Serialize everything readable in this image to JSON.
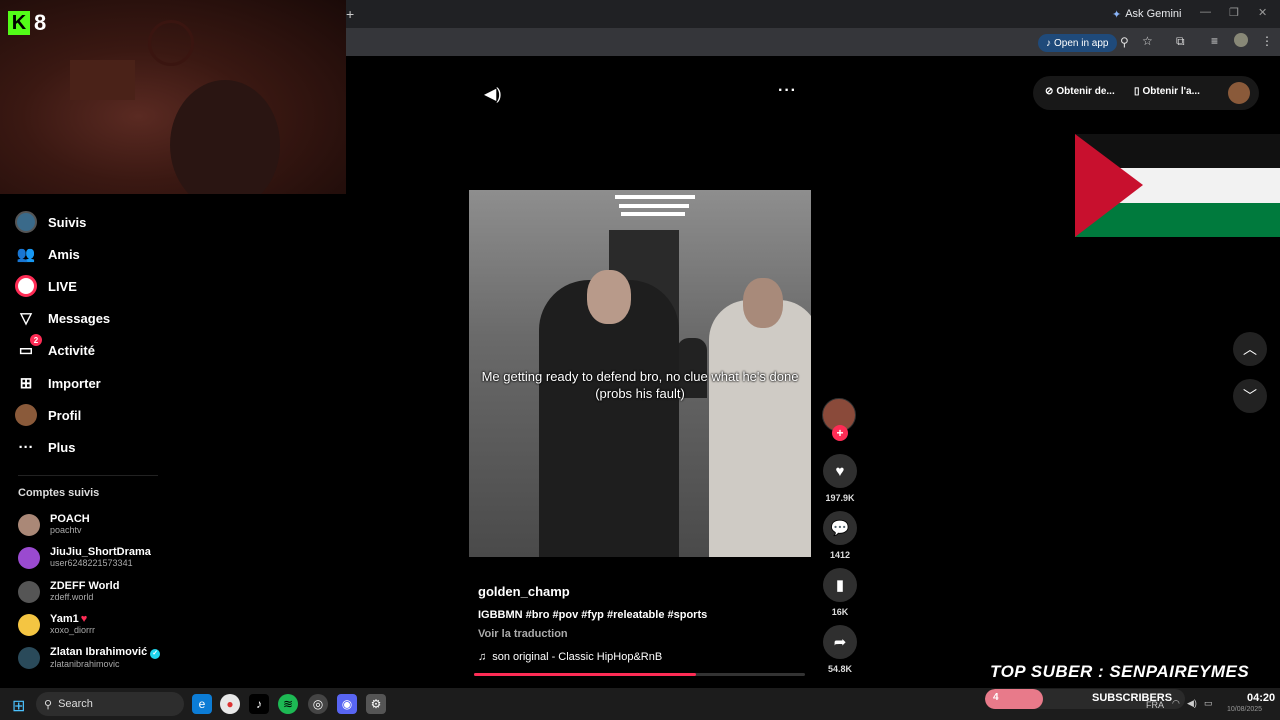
{
  "browser": {
    "new_tab_icon": "plus-icon",
    "ask_gemini": "Ask Gemini",
    "open_in_app": "Open in app"
  },
  "stream_overlay": {
    "platform_logo": "K",
    "viewer_count": "8",
    "top_suber": "TOP SUBER : SENPAIREYMES",
    "subscribers_label": "SUBSCRIBERS",
    "subscribers_count": "4",
    "subscribers_progress": 0.29
  },
  "sidebar": {
    "items": [
      {
        "label": "Suivis",
        "icon": "following-avatar-icon"
      },
      {
        "label": "Amis",
        "icon": "friends-icon"
      },
      {
        "label": "LIVE",
        "icon": "live-icon"
      },
      {
        "label": "Messages",
        "icon": "messages-icon"
      },
      {
        "label": "Activité",
        "icon": "activity-icon",
        "badge": "2"
      },
      {
        "label": "Importer",
        "icon": "upload-icon"
      },
      {
        "label": "Profil",
        "icon": "profile-icon"
      },
      {
        "label": "Plus",
        "icon": "more-icon"
      }
    ],
    "following_title": "Comptes suivis",
    "following": [
      {
        "name": "POACH",
        "handle": "poachtv"
      },
      {
        "name": "JiuJiu_ShortDrama",
        "handle": "user6248221573341"
      },
      {
        "name": "ZDEFF World",
        "handle": "zdeff.world"
      },
      {
        "name": "Yam1",
        "handle": "xoxo_diorrr",
        "heart": "♥"
      },
      {
        "name": "Zlatan Ibrahimović",
        "handle": "zlatanibrahimovic",
        "verified": "✓"
      }
    ]
  },
  "video": {
    "caption": "Me getting ready to defend bro, no clue what he's done (probs his fault)",
    "author": "golden_champ",
    "description": "IGBBMN #bro #pov #fyp #releatable #sports",
    "translate": "Voir la traduction",
    "sound": "son original - Classic HipHop&RnB",
    "progress": 0.67
  },
  "actions": {
    "likes": "197.9K",
    "comments": "1412",
    "saves": "16K",
    "shares": "54.8K"
  },
  "top_right": {
    "get_desktop": "Obtenir de...",
    "get_app": "Obtenir l'a..."
  },
  "taskbar": {
    "search": "Search",
    "lang": "FRA",
    "time": "04:20",
    "date": "10/08/2025"
  },
  "colors": {
    "accent": "#fe2c55",
    "kick_green": "#53fc18",
    "flag_red": "#c8102e",
    "flag_green": "#007a3d"
  }
}
